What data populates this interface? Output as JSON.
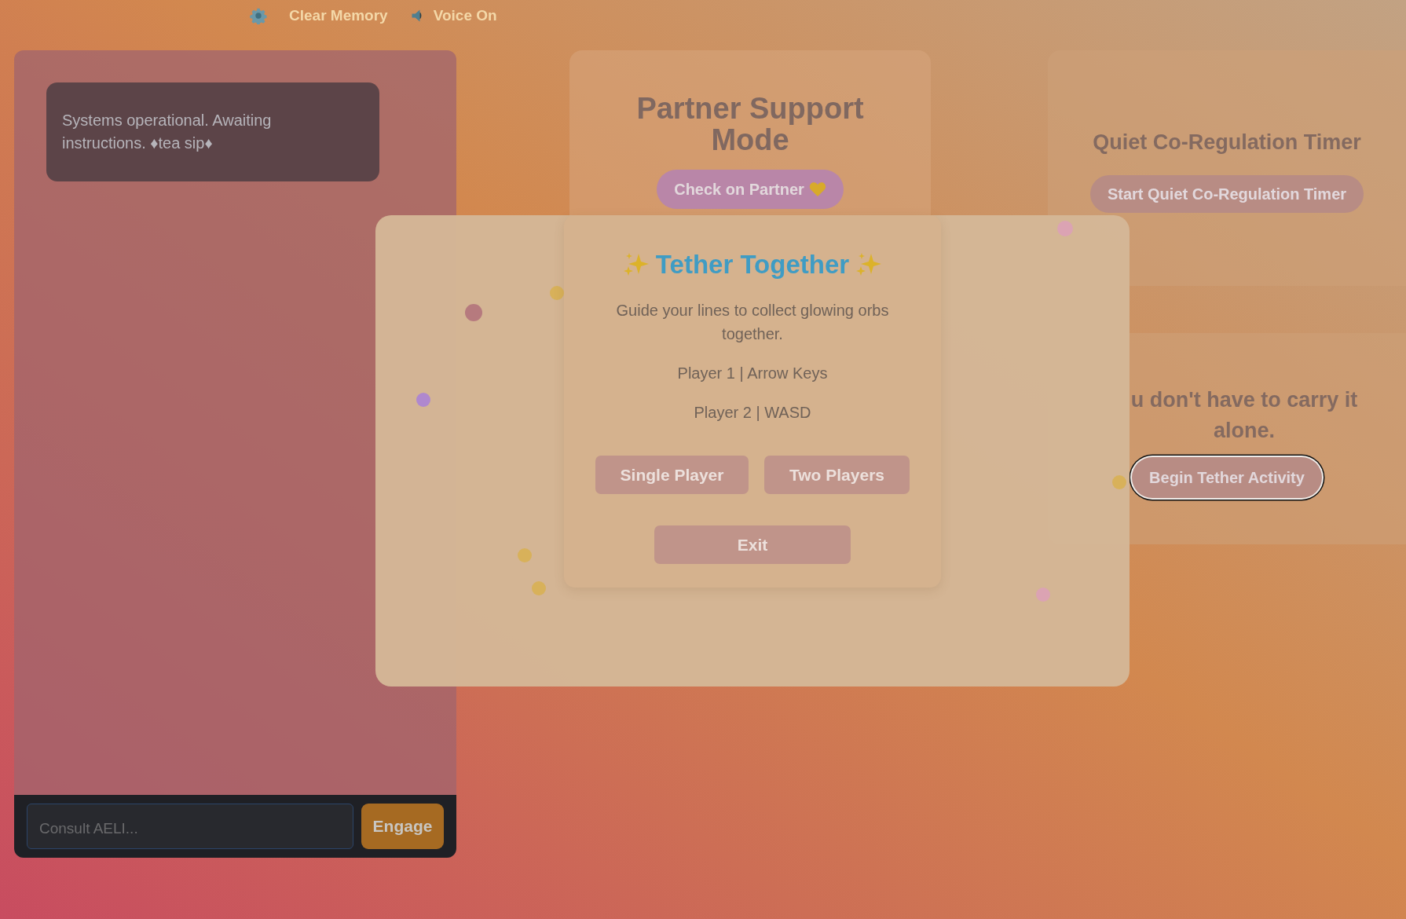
{
  "toolbar": {
    "items": [
      {
        "kind": "settings"
      },
      {
        "kind": "text",
        "label": "Clear Memory"
      },
      {
        "kind": "voice",
        "label": "Voice On"
      }
    ]
  },
  "chat": {
    "messages": [
      {
        "text": "Systems operational. Awaiting instructions. ♦tea sip♦"
      }
    ],
    "input": {
      "placeholder": "Consult AELI..."
    },
    "send_button": "Engage"
  },
  "cards": [
    {
      "title": "Partner Support Mode",
      "button": "Check on Partner",
      "kind": "heart"
    },
    {
      "title": "Quiet Co-Regulation Timer",
      "button": "Start Quiet Co-Regulation Timer",
      "kind": "plain"
    },
    {
      "title": "u don't have to carry it alone.",
      "button": "Begin Tether Activity",
      "kind": "plain",
      "focused": true
    }
  ],
  "modal": {
    "title": "Tether Together",
    "description": "Guide your lines to collect glowing orbs together.",
    "controls": [
      "Player 1 | Arrow Keys",
      "Player 2 | WASD"
    ],
    "buttons": [
      "Single Player",
      "Two Players"
    ],
    "exit": "Exit"
  }
}
